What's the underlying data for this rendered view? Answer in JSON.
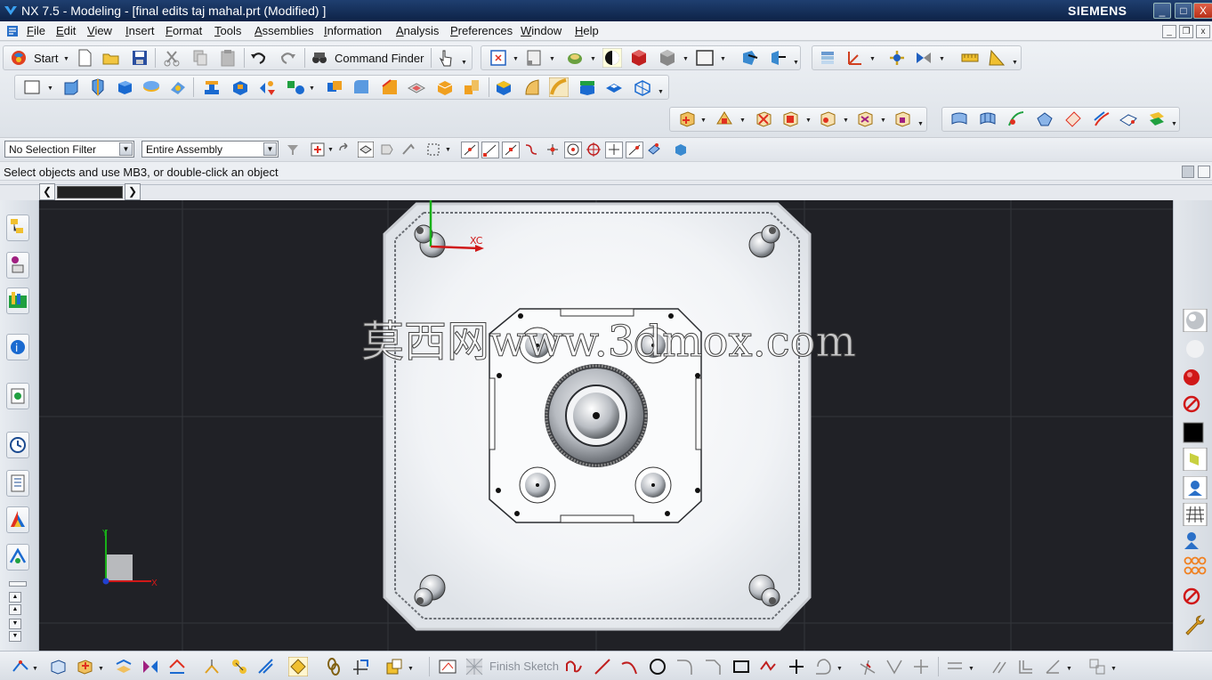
{
  "window": {
    "title": "NX 7.5 - Modeling - [final edits taj mahal.prt (Modified) ]",
    "brand": "SIEMENS",
    "controls": {
      "minimize": "_",
      "maximize": "□",
      "close": "X"
    }
  },
  "menu": {
    "items": [
      {
        "label": "File",
        "underline": "F",
        "rest": "ile"
      },
      {
        "label": "Edit",
        "underline": "E",
        "rest": "dit"
      },
      {
        "label": "View",
        "underline": "V",
        "rest": "iew"
      },
      {
        "label": "Insert",
        "underline": "I",
        "rest": "nsert"
      },
      {
        "label": "Format",
        "underline": "F",
        "rest": "ormat"
      },
      {
        "label": "Tools",
        "underline": "T",
        "rest": "ools"
      },
      {
        "label": "Assemblies",
        "underline": "A",
        "rest": "ssemblies"
      },
      {
        "label": "Information",
        "underline": "I",
        "rest": "nformation"
      },
      {
        "label": "Analysis",
        "underline": "A",
        "rest": "nalysis"
      },
      {
        "label": "Preferences",
        "underline": "P",
        "rest": "references"
      },
      {
        "label": "Window",
        "underline": "W",
        "rest": "indow"
      },
      {
        "label": "Help",
        "underline": "H",
        "rest": "elp"
      }
    ]
  },
  "standard_toolbar": {
    "start_label": "Start",
    "command_finder_label": "Command Finder"
  },
  "selection_bar": {
    "type_filter": "No Selection Filter",
    "scope": "Entire Assembly"
  },
  "cue_line": "Select objects and use MB3, or double-click an object",
  "viewport": {
    "wcs_label": "XC",
    "triad_x": "X",
    "triad_y": "Y",
    "watermark": "莫西网www.3dmox.com",
    "background": "#202126"
  },
  "sketch_toolbar": {
    "finish_sketch_label": "Finish Sketch"
  },
  "colors": {
    "title_bar": "#15305a",
    "viewport_bg": "#202126",
    "wcs_x": "#d01818",
    "wcs_y": "#18b018"
  }
}
